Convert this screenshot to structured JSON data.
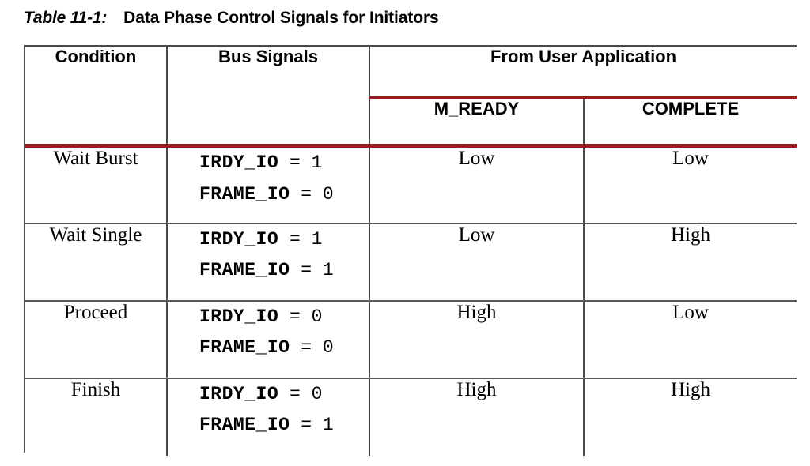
{
  "caption": {
    "label": "Table 11-1:",
    "title": "Data Phase Control Signals for Initiators"
  },
  "colors": {
    "rule_red": "#9c1a22",
    "border_dark": "#4a4a4a",
    "row_divider": "#58585a",
    "text": "#000000",
    "background": "#ffffff"
  },
  "table": {
    "headers": {
      "condition": "Condition",
      "bus_signals": "Bus Signals",
      "group": "From User Application",
      "m_ready": "M_READY",
      "complete": "COMPLETE"
    },
    "rows": [
      {
        "condition": "Wait Burst",
        "signals": [
          {
            "name": "IRDY_IO",
            "eq": "=",
            "value": "1"
          },
          {
            "name": "FRAME_IO",
            "eq": "=",
            "value": "0"
          }
        ],
        "m_ready": "Low",
        "complete": "Low"
      },
      {
        "condition": "Wait Single",
        "signals": [
          {
            "name": "IRDY_IO",
            "eq": "=",
            "value": "1"
          },
          {
            "name": "FRAME_IO",
            "eq": "=",
            "value": "1"
          }
        ],
        "m_ready": "Low",
        "complete": "High"
      },
      {
        "condition": "Proceed",
        "signals": [
          {
            "name": "IRDY_IO",
            "eq": "=",
            "value": "0"
          },
          {
            "name": "FRAME_IO",
            "eq": "=",
            "value": "0"
          }
        ],
        "m_ready": "High",
        "complete": "Low"
      },
      {
        "condition": "Finish",
        "signals": [
          {
            "name": "IRDY_IO",
            "eq": "=",
            "value": "0"
          },
          {
            "name": "FRAME_IO",
            "eq": "=",
            "value": "1"
          }
        ],
        "m_ready": "High",
        "complete": "High"
      }
    ]
  }
}
